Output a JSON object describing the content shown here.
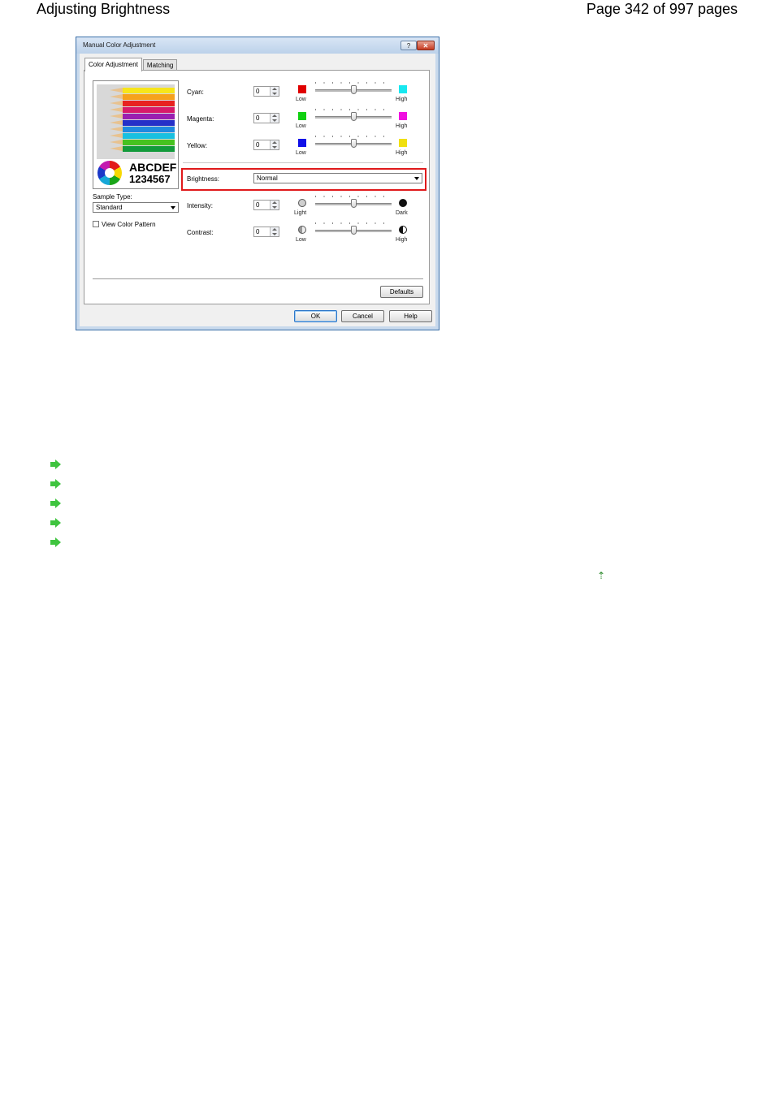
{
  "page_header": {
    "title": "Adjusting Brightness",
    "page_number": "Page 342 of 997 pages"
  },
  "dialog": {
    "title": "Manual Color Adjustment",
    "help_button": "?",
    "close_button": "✕",
    "tabs": [
      {
        "label": "Color Adjustment",
        "active": true
      },
      {
        "label": "Matching",
        "active": false
      }
    ],
    "preview": {
      "text_line1": "ABCDEF",
      "text_line2": "1234567"
    },
    "sample_type": {
      "label": "Sample Type:",
      "value": "Standard"
    },
    "view_color_pattern": {
      "label": "View Color Pattern",
      "checked": false
    },
    "color_rows": [
      {
        "label": "Cyan:",
        "value": "0",
        "low_label": "Low",
        "high_label": "High",
        "low_color": "#e00000",
        "high_color": "#18e8f0",
        "slider_level": 0.5
      },
      {
        "label": "Magenta:",
        "value": "0",
        "low_label": "Low",
        "high_label": "High",
        "low_color": "#10d010",
        "high_color": "#f010e0",
        "slider_level": 0.5
      },
      {
        "label": "Yellow:",
        "value": "0",
        "low_label": "Low",
        "high_label": "High",
        "low_color": "#1010e8",
        "high_color": "#f0e010",
        "slider_level": 0.5
      }
    ],
    "brightness": {
      "label": "Brightness:",
      "value": "Normal",
      "highlight_color": "#e0191b"
    },
    "intensity": {
      "label": "Intensity:",
      "value": "0",
      "low_label": "Light",
      "high_label": "Dark",
      "slider_level": 0.5
    },
    "contrast": {
      "label": "Contrast:",
      "value": "0",
      "low_label": "Low",
      "high_label": "High",
      "slider_level": 0.5
    },
    "buttons": {
      "defaults": "Defaults",
      "ok": "OK",
      "cancel": "Cancel",
      "help": "Help"
    }
  },
  "related_links_icon": "green-arrow-icon",
  "related_links_count": 5,
  "top_icon": "page-top-icon"
}
